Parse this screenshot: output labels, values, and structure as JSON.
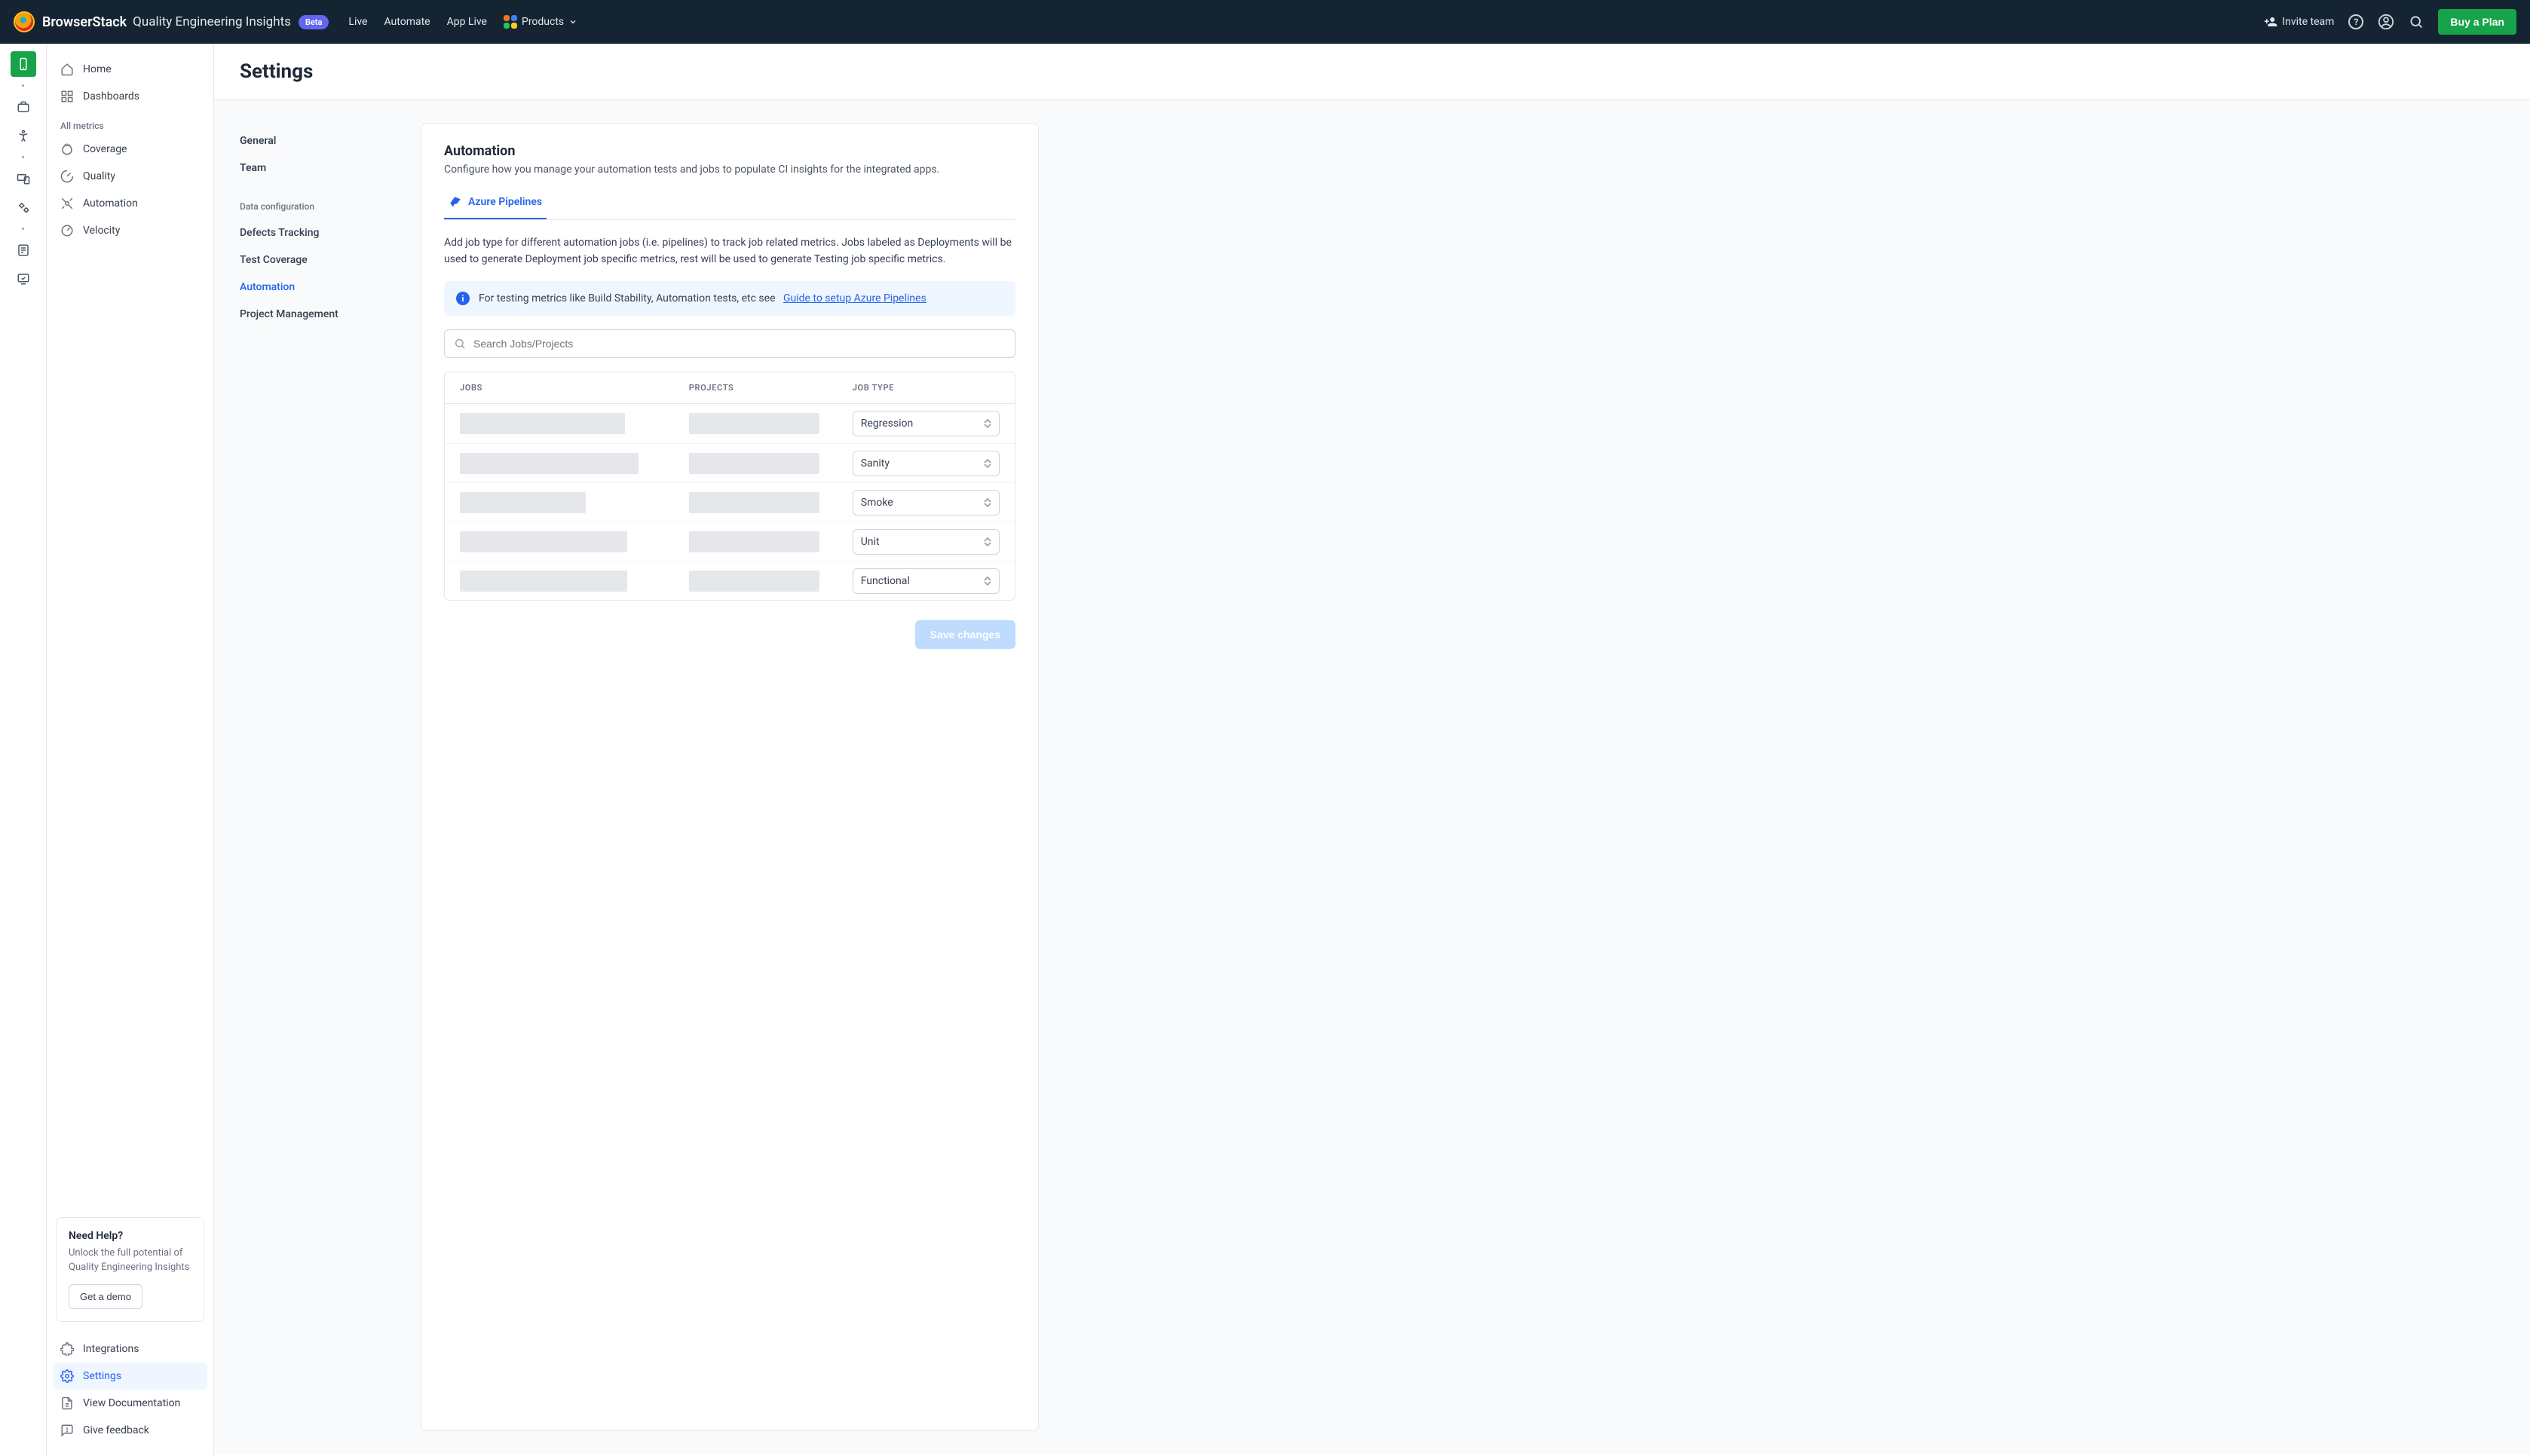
{
  "topbar": {
    "brand": "BrowserStack",
    "product_title": "Quality Engineering Insights",
    "beta_label": "Beta",
    "nav": {
      "live": "Live",
      "automate": "Automate",
      "app_live": "App Live",
      "products": "Products"
    },
    "invite_label": "Invite team",
    "buy_plan_label": "Buy a Plan"
  },
  "sidebar": {
    "items": {
      "home": "Home",
      "dashboards": "Dashboards",
      "section_label": "All metrics",
      "coverage": "Coverage",
      "quality": "Quality",
      "automation": "Automation",
      "velocity": "Velocity",
      "integrations": "Integrations",
      "settings": "Settings",
      "docs": "View Documentation",
      "feedback": "Give feedback"
    },
    "help_card": {
      "title": "Need Help?",
      "body": "Unlock the full potential of Quality Engineering Insights",
      "cta": "Get a demo"
    }
  },
  "page": {
    "title": "Settings"
  },
  "settings_nav": {
    "general": "General",
    "team": "Team",
    "group_label": "Data configuration",
    "defects": "Defects Tracking",
    "test_coverage": "Test Coverage",
    "automation": "Automation",
    "project_mgmt": "Project Management"
  },
  "card": {
    "heading": "Automation",
    "subtitle": "Configure how you manage your automation tests and jobs to populate CI insights for the integrated apps.",
    "tab_label": "Azure Pipelines",
    "description": "Add job type for different automation jobs (i.e. pipelines) to track job related metrics. Jobs labeled as Deployments will be used to generate Deployment job specific metrics, rest will be used to generate Testing job specific metrics.",
    "banner_text": "For testing metrics like Build Stability, Automation tests, etc see",
    "banner_link": "Guide to setup Azure Pipelines",
    "search_placeholder": "Search Jobs/Projects",
    "columns": {
      "jobs": "JOBS",
      "projects": "PROJECTS",
      "job_type": "JOB TYPE"
    },
    "rows": [
      {
        "job_type": "Regression"
      },
      {
        "job_type": "Sanity"
      },
      {
        "job_type": "Smoke"
      },
      {
        "job_type": "Unit"
      },
      {
        "job_type": "Functional"
      }
    ],
    "save_label": "Save changes"
  }
}
